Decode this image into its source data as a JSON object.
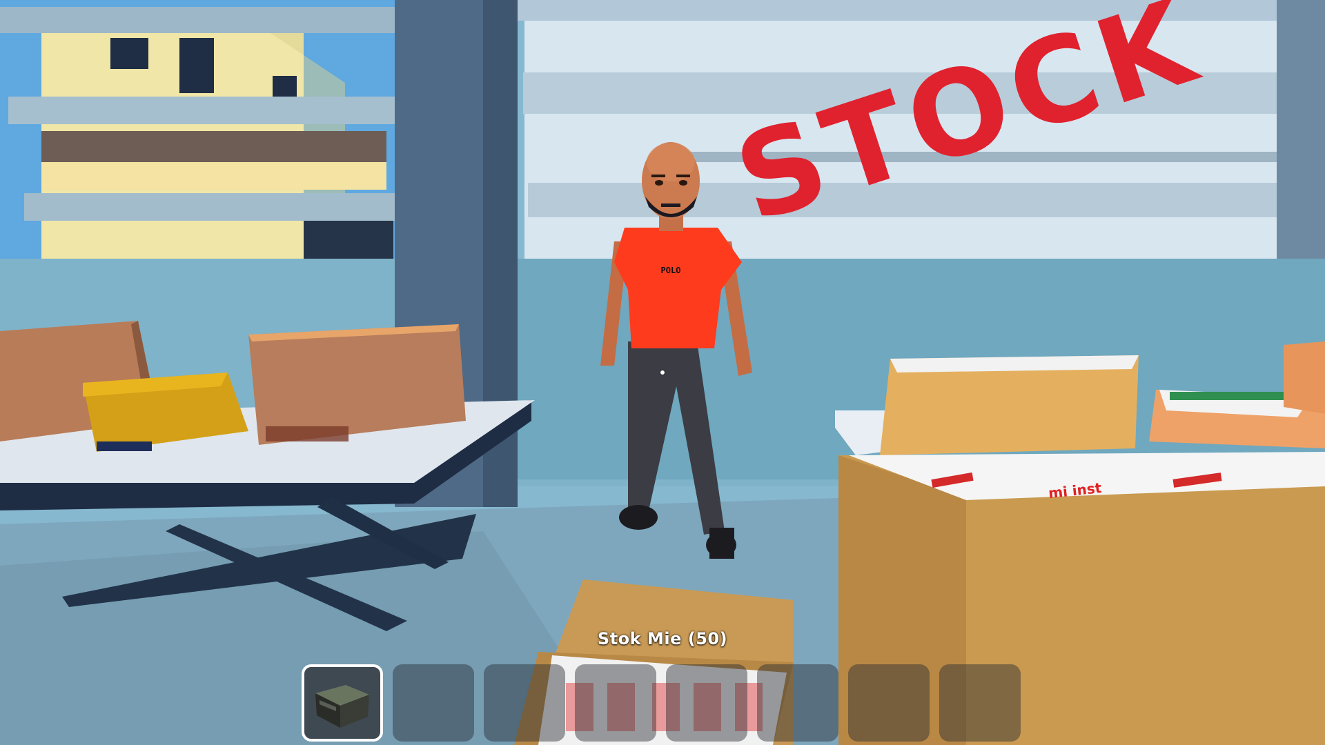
{
  "scene": {
    "sign_text": "STOCK",
    "shirt_logo": "POLO",
    "box_brand_text": "mi inst"
  },
  "hud": {
    "held_item_label": "Stok Mie (50)",
    "crosshair": "crosshair-dot",
    "hotbar": {
      "selected_index": 0,
      "slots": [
        {
          "icon": "noodle-crate-icon",
          "selected": true
        },
        {
          "icon": "",
          "selected": false
        },
        {
          "icon": "",
          "selected": false
        },
        {
          "icon": "",
          "selected": false
        },
        {
          "icon": "",
          "selected": false
        },
        {
          "icon": "",
          "selected": false
        },
        {
          "icon": "",
          "selected": false
        },
        {
          "icon": "",
          "selected": false
        }
      ]
    }
  },
  "colors": {
    "sign_red": "#e0222e",
    "shirt_red": "#ff3b1e",
    "slot_border_selected": "#ffffff"
  }
}
